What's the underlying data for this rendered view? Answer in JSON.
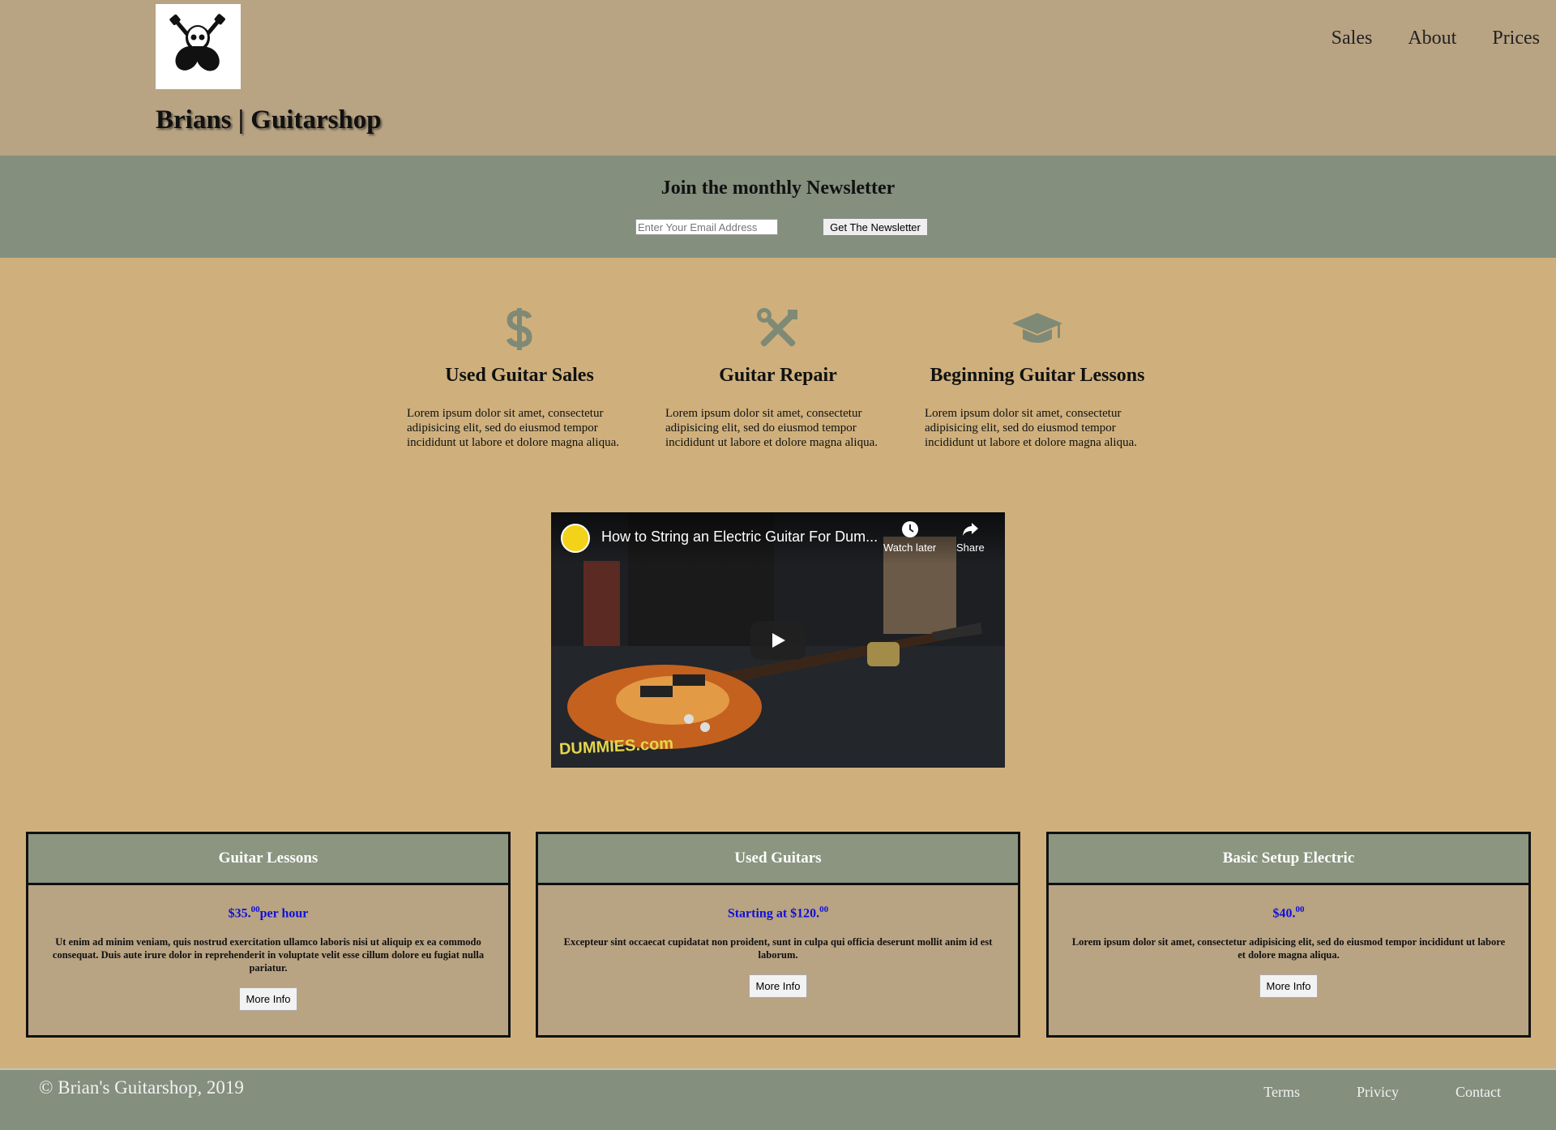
{
  "header": {
    "brand": "Brians | Guitarshop",
    "logo_icon": "skull-crossed-guitars-icon",
    "nav": [
      {
        "label": "Sales"
      },
      {
        "label": "About"
      },
      {
        "label": "Prices"
      }
    ]
  },
  "newsletter": {
    "title": "Join the monthly Newsletter",
    "email_placeholder": "Enter Your Email Address",
    "email_value": "",
    "button_label": "Get The Newsletter"
  },
  "services": [
    {
      "icon": "dollar-icon",
      "title": "Used Guitar Sales",
      "text": "Lorem ipsum dolor sit amet, consectetur adipisicing elit, sed do eiusmod tempor incididunt ut labore et dolore magna aliqua."
    },
    {
      "icon": "tools-icon",
      "title": "Guitar Repair",
      "text": "Lorem ipsum dolor sit amet, consectetur adipisicing elit, sed do eiusmod tempor incididunt ut labore et dolore magna aliqua."
    },
    {
      "icon": "graduation-cap-icon",
      "title": "Beginning Guitar Lessons",
      "text": "Lorem ipsum dolor sit amet, consectetur adipisicing elit, sed do eiusmod tempor incididunt ut labore et dolore magna aliqua."
    }
  ],
  "video": {
    "title": "How to String an Electric Guitar For Dum...",
    "watch_later": "Watch later",
    "share": "Share",
    "watermark": "DUMMIES.com"
  },
  "cards": [
    {
      "title": "Guitar Lessons",
      "price_main": "$35.",
      "price_cents": "00",
      "price_suffix": "per hour",
      "text": "Ut enim ad minim veniam, quis nostrud exercitation ullamco laboris nisi ut aliquip ex ea commodo consequat. Duis aute irure dolor in reprehenderit in voluptate velit esse cillum dolore eu fugiat nulla pariatur.",
      "button": "More Info"
    },
    {
      "title": "Used Guitars",
      "price_main": "Starting at $120.",
      "price_cents": "00",
      "price_suffix": "",
      "text": "Excepteur sint occaecat cupidatat non proident, sunt in culpa qui officia deserunt mollit anim id est laborum.",
      "button": "More Info"
    },
    {
      "title": "Basic Setup Electric",
      "price_main": "$40.",
      "price_cents": "00",
      "price_suffix": "",
      "text": "Lorem ipsum dolor sit amet, consectetur adipisicing elit, sed do eiusmod tempor incididunt ut labore et dolore magna aliqua.",
      "button": "More Info"
    }
  ],
  "footer": {
    "copyright": "© Brian's Guitarshop, 2019",
    "links": [
      {
        "label": "Terms"
      },
      {
        "label": "Privicy"
      },
      {
        "label": "Contact"
      }
    ]
  },
  "colors": {
    "header_bg": "#b8a383",
    "band_bg": "#848f7e",
    "page_bg": "#cfb07c",
    "price_color": "#1010d8"
  }
}
